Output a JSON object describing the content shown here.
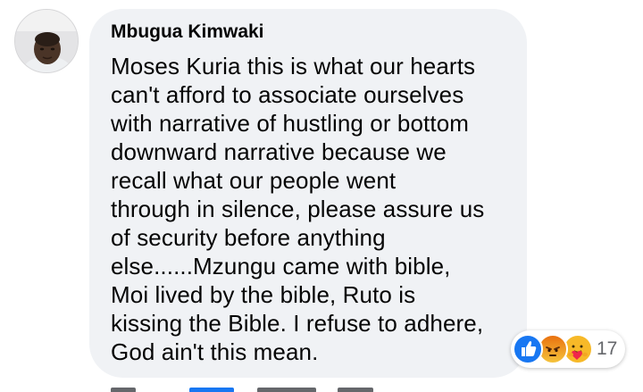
{
  "comment": {
    "author": "Mbugua Kimwaki",
    "lines": [
      "Moses Kuria this is what our hearts",
      "can't afford to associate ourselves",
      "with narrative of hustling or bottom",
      "downward narrative because we",
      "recall what our people went",
      "through in silence, please assure us",
      "of security before anything",
      "else......Mzungu came with bible,",
      "Moi lived by the bible, Ruto is",
      "kissing the Bible. I refuse to adhere,",
      "God ain't this mean."
    ]
  },
  "reactions": {
    "count": "17",
    "icons": [
      "like-icon",
      "angry-icon",
      "care-icon"
    ]
  },
  "colors": {
    "bubble": "#f0f2f5",
    "text": "#050505",
    "meta": "#65676b",
    "like": "#1877f2"
  }
}
